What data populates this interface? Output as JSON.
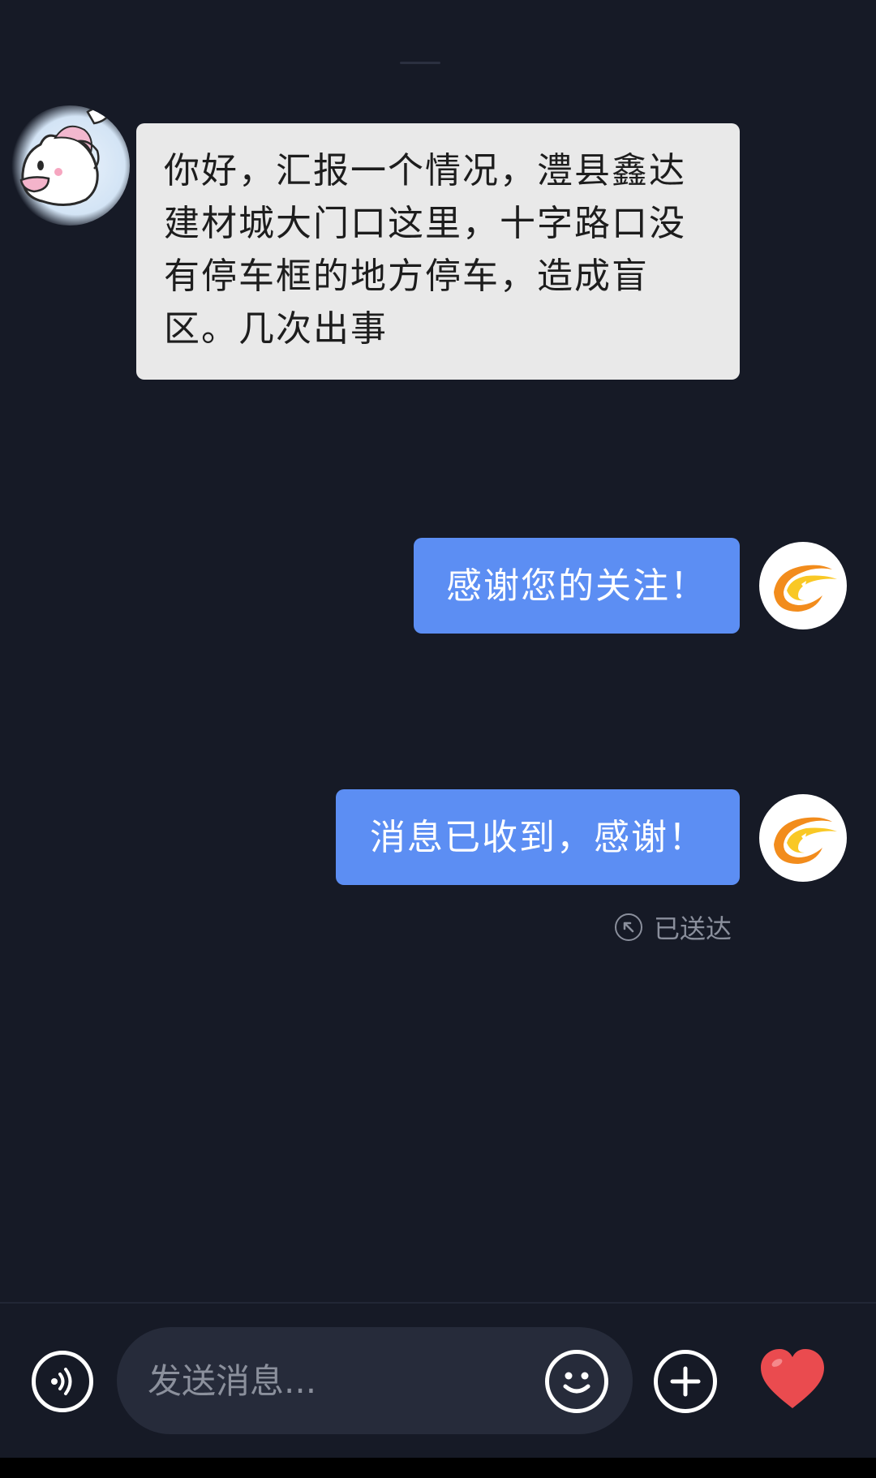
{
  "chat": {
    "incoming": {
      "text": "你好，汇报一个情况，澧县鑫达建材城大门口这里，十字路口没有停车框的地方停车，造成盲区。几次出事"
    },
    "outgoing": [
      {
        "text": "感谢您的关注！"
      },
      {
        "text": "消息已收到，感谢！"
      }
    ],
    "status": "已送达"
  },
  "input_bar": {
    "placeholder": "发送消息..."
  },
  "colors": {
    "background": "#161a26",
    "incoming_bubble": "#e9e9e9",
    "outgoing_bubble": "#5c8ef3",
    "heart": "#ea4b4f",
    "logo_orange": "#f28c1c",
    "logo_yellow": "#f9c825"
  },
  "icons": [
    "voice-icon",
    "emoji-icon",
    "plus-icon",
    "heart-icon",
    "delivered-icon",
    "unicorn-avatar",
    "official-logo"
  ]
}
